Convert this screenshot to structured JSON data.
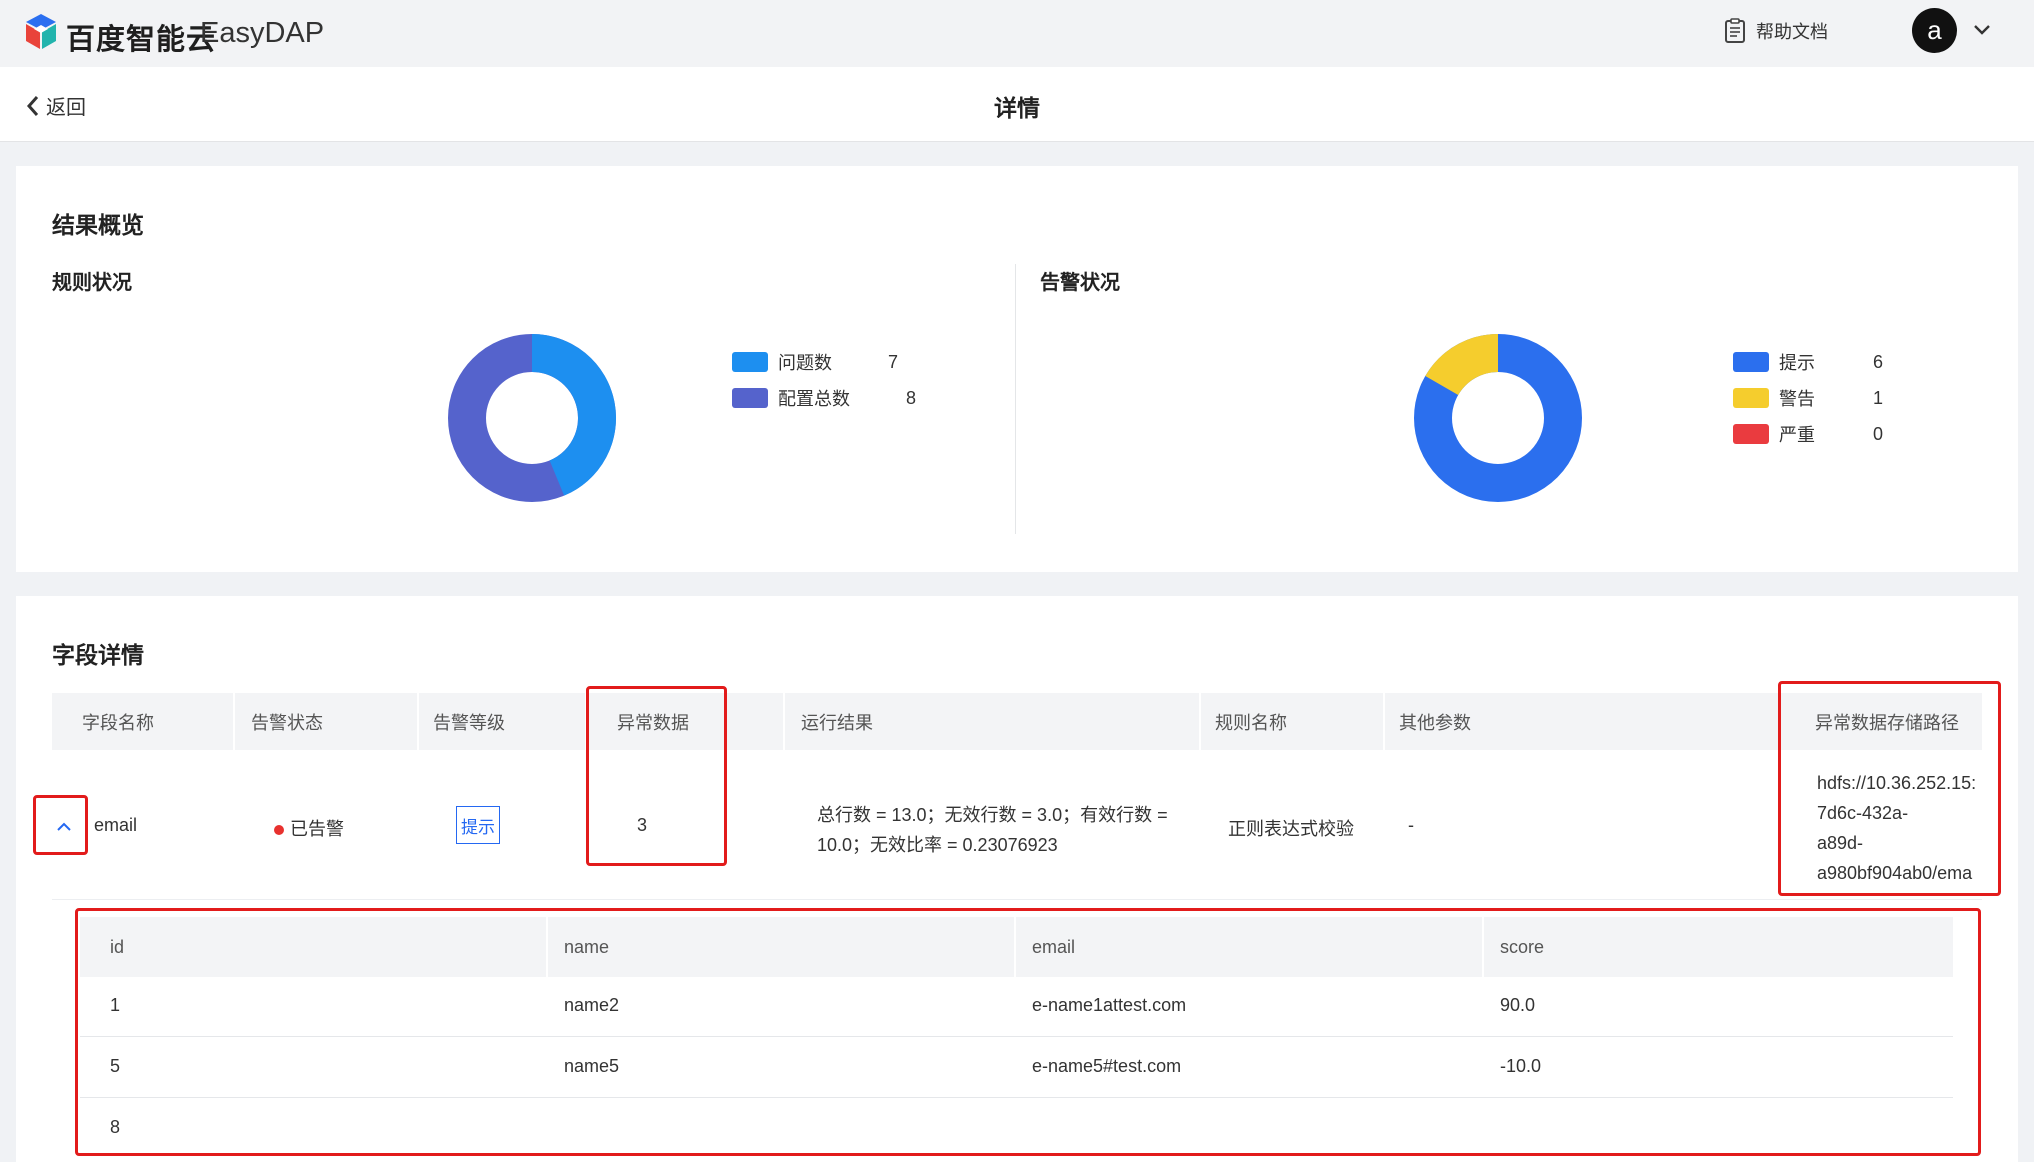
{
  "header": {
    "brand_cn": "百度智能云",
    "brand_en": "EasyDAP",
    "help_label": "帮助文档",
    "avatar_letter": "a"
  },
  "page": {
    "back_label": "返回",
    "title": "详情"
  },
  "overview": {
    "title": "结果概览",
    "rules": {
      "title": "规则状况",
      "legend": [
        {
          "label": "问题数",
          "value": "7",
          "color": "#1d8ff0"
        },
        {
          "label": "配置总数",
          "value": "8",
          "color": "#5563cc"
        }
      ]
    },
    "alerts": {
      "title": "告警状况",
      "legend": [
        {
          "label": "提示",
          "value": "6",
          "color": "#2b6fee"
        },
        {
          "label": "警告",
          "value": "1",
          "color": "#f5cd2d"
        },
        {
          "label": "严重",
          "value": "0",
          "color": "#ea3b3f"
        }
      ]
    }
  },
  "fields": {
    "title": "字段详情",
    "columns": [
      "字段名称",
      "告警状态",
      "告警等级",
      "异常数据",
      "运行结果",
      "规则名称",
      "其他参数",
      "异常数据存储路径"
    ],
    "row": {
      "field_name": "email",
      "alert_status": "已告警",
      "alert_level": "提示",
      "abnormal_count": "3",
      "run_result_line1": "总行数 = 13.0；无效行数 = 3.0；有效行数 =",
      "run_result_line2": "10.0；无效比率 = 0.23076923",
      "rule_name": "正则表达式校验",
      "other_params": "-",
      "path_lines": [
        "hdfs://10.36.252.15:",
        "7d6c-432a-",
        "a89d-",
        "a980bf904ab0/ema"
      ]
    },
    "sub_table": {
      "columns": [
        "id",
        "name",
        "email",
        "score"
      ],
      "rows": [
        [
          "1",
          "name2",
          "e-name1attest.com",
          "90.0"
        ],
        [
          "5",
          "name5",
          "e-name5#test.com",
          "-10.0"
        ],
        [
          "8",
          "",
          "",
          ""
        ]
      ]
    }
  },
  "colors": {
    "accent": "#2468f2",
    "alert_red": "#e8312e",
    "annotation_red": "#e21b1b"
  }
}
